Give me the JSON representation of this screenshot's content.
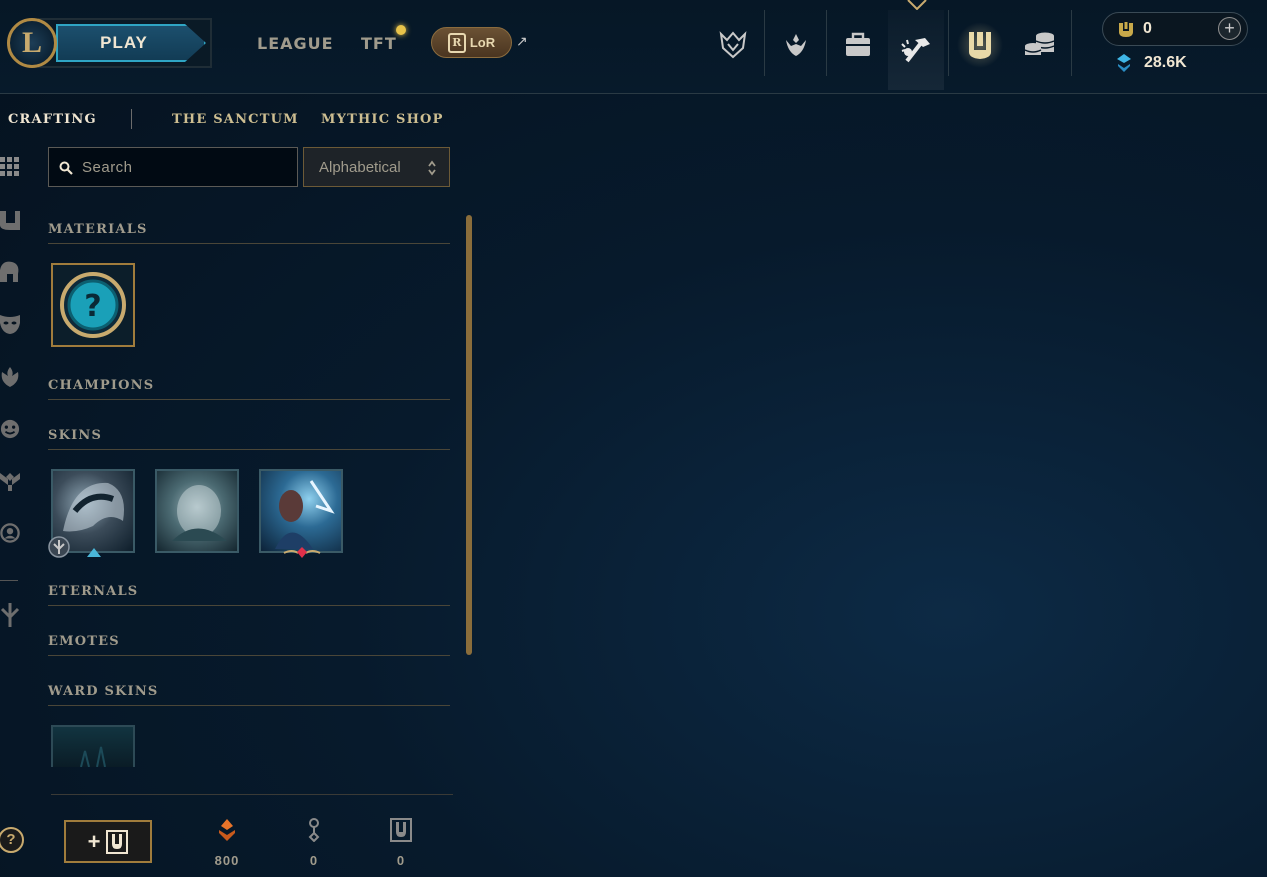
{
  "header": {
    "logo_letter": "L",
    "play_label": "PLAY",
    "nav": {
      "league": "LEAGUE",
      "tft": "TFT",
      "lor": "LoR",
      "lor_badge": "R"
    },
    "icons": [
      "worlds-icon",
      "ranked-crest-icon",
      "store-bag-icon",
      "crafting-hammer-icon",
      "loot-chest-icon",
      "coin-stack-icon"
    ],
    "currency": {
      "mythic": "0",
      "blue_essence": "28.6K",
      "plus": "+"
    }
  },
  "subnav": {
    "tabs": [
      {
        "label": "CRAFTING",
        "active": true
      },
      {
        "label": "THE SANCTUM",
        "active": false
      },
      {
        "label": "MYTHIC SHOP",
        "active": false
      }
    ]
  },
  "filters": {
    "search_placeholder": "Search",
    "sort_value": "Alphabetical"
  },
  "sections": {
    "materials": "MATERIALS",
    "champions": "CHAMPIONS",
    "skins": "SKINS",
    "eternals": "ETERNALS",
    "emotes": "EMOTES",
    "ward_skins": "WARD SKINS"
  },
  "material_tile": {
    "glyph": "?"
  },
  "footer": {
    "add_label": "+",
    "orange_essence": "800",
    "keys": "0",
    "chests": "0"
  },
  "help": "?",
  "colors": {
    "gold": "#c8aa6e",
    "cyan": "#0ac8b9",
    "bg": "#05121f"
  }
}
